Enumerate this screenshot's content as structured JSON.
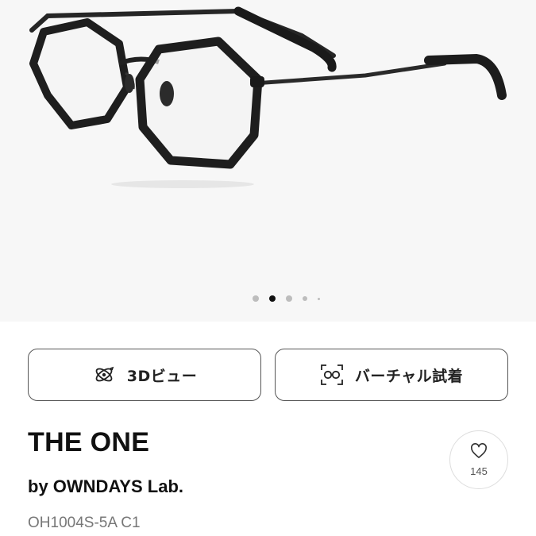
{
  "hero": {
    "image": "black-octagonal-eyeglasses",
    "carousel": {
      "count": 5,
      "active_index": 1
    }
  },
  "actions": {
    "view_3d": {
      "label": "3Dビュー",
      "icon": "3d-rotate-icon"
    },
    "virtual_try_on": {
      "label": "バーチャル試着",
      "icon": "face-glasses-icon"
    }
  },
  "product": {
    "name": "THE ONE",
    "brand": "by OWNDAYS Lab.",
    "model": "OH1004S-5A C1"
  },
  "favorite": {
    "icon": "heart-icon",
    "count": "145"
  },
  "colors": {
    "frame": "#1e1e1e",
    "accent_dot": "#111111",
    "muted_text": "#777777",
    "hero_bg": "#f7f7f7"
  }
}
